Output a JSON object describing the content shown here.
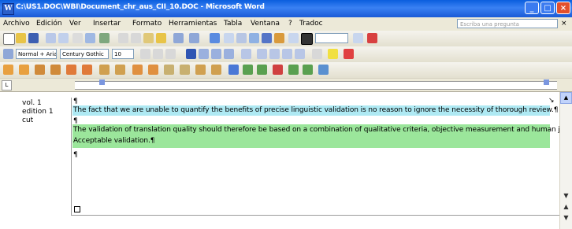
{
  "window": {
    "title": "C:\\US1.DOC\\WBI\\Document_chr_aus_CII_10.DOC - Microsoft Word",
    "app_icon": "W",
    "controls": {
      "minimize": "_",
      "maximize": "□",
      "close": "×"
    }
  },
  "menu": {
    "items": [
      "Archivo",
      "Edición",
      "Ver",
      "Insertar",
      "Formato",
      "Herramientas",
      "Tabla",
      "Ventana",
      "?",
      "Tradoc"
    ],
    "help_placeholder": "Escriba una pregunta",
    "help_close": "×"
  },
  "toolbar_formatting": {
    "style_value": "Normal + Arial",
    "font_value": "Century Gothic",
    "size_value": "10"
  },
  "ruler": {
    "corner": "L"
  },
  "document": {
    "citations": [
      "vol. 1",
      "edition 1",
      "cut"
    ],
    "paragraph_mark": "¶",
    "paragraph1": "The fact that we are unable to quantify the benefits of precise linguistic validation is no reason to ignore the necessity of thorough review.¶",
    "paragraph2": "The validation of translation quality should therefore be based on a combination of qualitative criteria, objective measurement and human judgment.",
    "paragraph2_line2": "Acceptable validation.¶"
  },
  "scrollbar": {
    "up": "▲",
    "down": "▼",
    "prev": "▲",
    "next": "▼"
  }
}
